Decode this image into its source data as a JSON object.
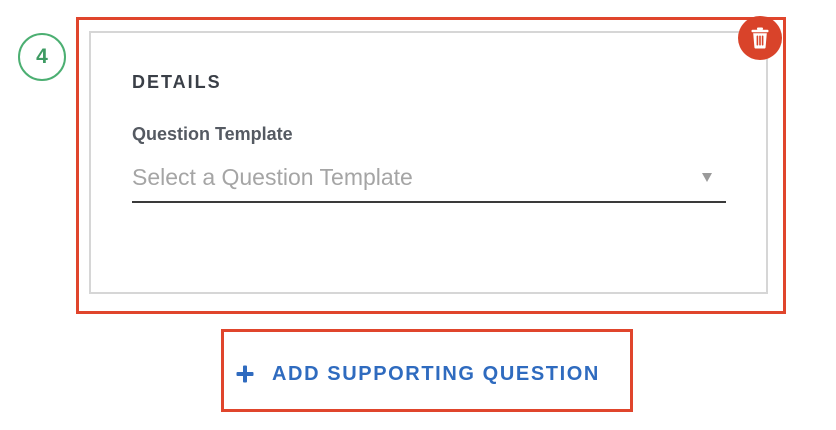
{
  "step": {
    "number": "4",
    "color": "#4caf72"
  },
  "details_card": {
    "heading": "DETAILS",
    "field_label": "Question Template",
    "select": {
      "placeholder": "Select a Question Template",
      "caret_icon": "caret-down-icon"
    },
    "delete_icon": "trash-icon",
    "delete_color": "#d9432a"
  },
  "add_supporting": {
    "label": "ADD SUPPORTING QUESTION",
    "icon": "plus-icon",
    "color": "#2f6bbf"
  },
  "highlight_color": "#e0452c"
}
